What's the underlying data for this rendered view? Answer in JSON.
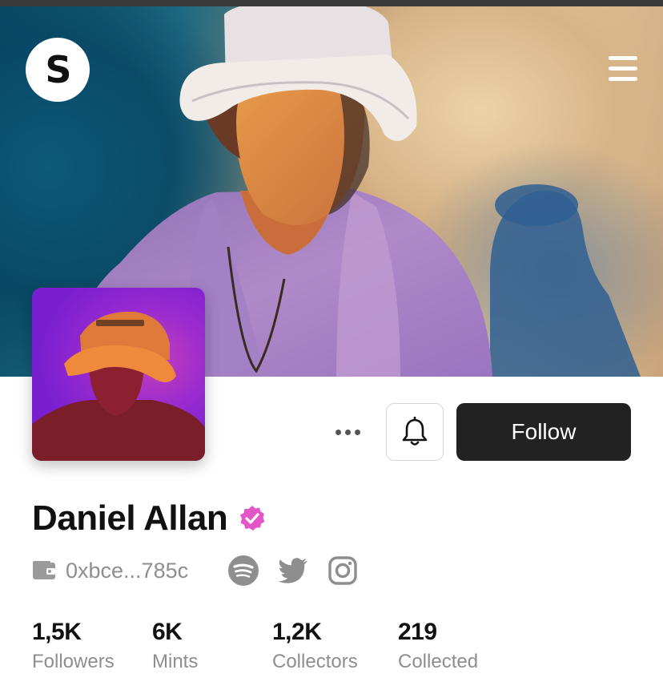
{
  "brand": {
    "logo_letter": "S"
  },
  "actions": {
    "follow_label": "Follow"
  },
  "profile": {
    "name": "Daniel Allan",
    "verified": true,
    "wallet": "0xbce...785c",
    "socials": [
      "spotify-icon",
      "twitter-icon",
      "instagram-icon"
    ]
  },
  "stats": [
    {
      "value": "1,5K",
      "label": "Followers"
    },
    {
      "value": "6K",
      "label": "Mints"
    },
    {
      "value": "1,2K",
      "label": "Collectors"
    },
    {
      "value": "219",
      "label": "Collected"
    }
  ],
  "colors": {
    "verified": "#e456c8",
    "follow_bg": "#222222",
    "muted": "#8e8e8e"
  }
}
